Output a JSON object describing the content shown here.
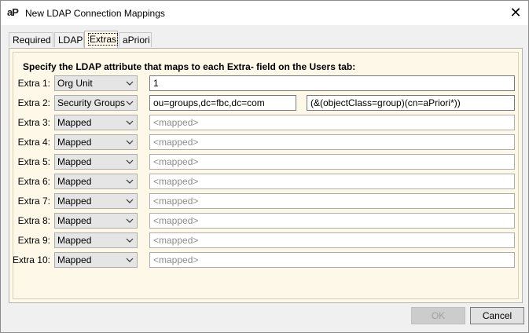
{
  "window": {
    "title": "New LDAP Connection Mappings",
    "logo_text": "aP"
  },
  "tabs": [
    {
      "label": "Required"
    },
    {
      "label": "LDAP"
    },
    {
      "label": "Extras"
    },
    {
      "label": "aPriori"
    }
  ],
  "extras": {
    "heading": "Specify the LDAP attribute that maps to each Extra- field on the Users tab:",
    "rows": [
      {
        "label": "Extra 1:",
        "mode": "Org Unit",
        "value": "1"
      },
      {
        "label": "Extra 2:",
        "mode": "Security Groups",
        "value": "ou=groups,dc=fbc,dc=com",
        "filter": "(&(objectClass=group)(cn=aPriori*))"
      },
      {
        "label": "Extra 3:",
        "mode": "Mapped",
        "placeholder": "<mapped>"
      },
      {
        "label": "Extra 4:",
        "mode": "Mapped",
        "placeholder": "<mapped>"
      },
      {
        "label": "Extra 5:",
        "mode": "Mapped",
        "placeholder": "<mapped>"
      },
      {
        "label": "Extra 6:",
        "mode": "Mapped",
        "placeholder": "<mapped>"
      },
      {
        "label": "Extra 7:",
        "mode": "Mapped",
        "placeholder": "<mapped>"
      },
      {
        "label": "Extra 8:",
        "mode": "Mapped",
        "placeholder": "<mapped>"
      },
      {
        "label": "Extra 9:",
        "mode": "Mapped",
        "placeholder": "<mapped>"
      },
      {
        "label": "Extra 10:",
        "mode": "Mapped",
        "placeholder": "<mapped>"
      }
    ]
  },
  "buttons": {
    "ok": "OK",
    "cancel": "Cancel"
  }
}
